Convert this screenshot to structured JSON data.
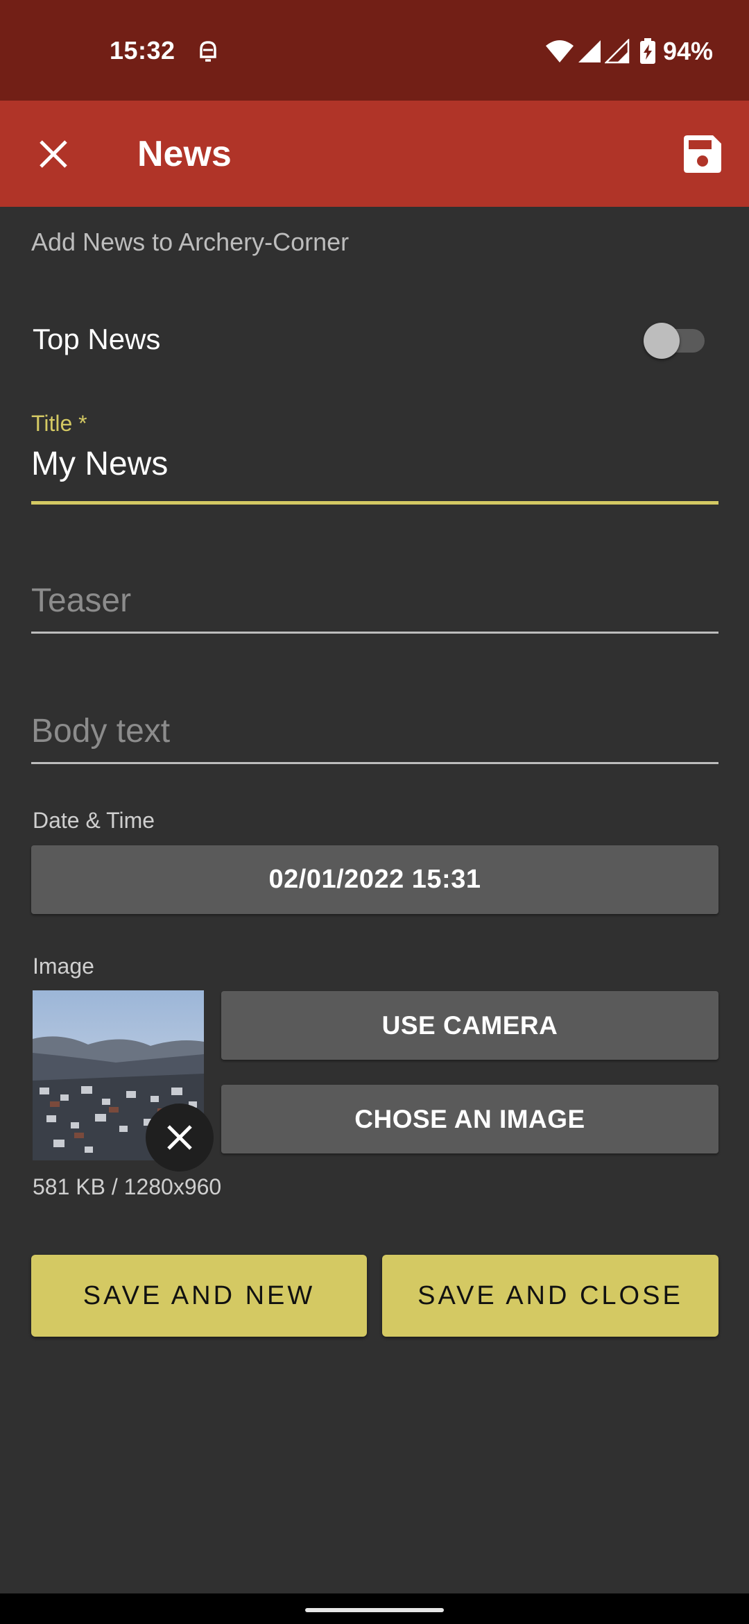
{
  "status_bar": {
    "time": "15:32",
    "notification_icon": "bell-icon",
    "wifi_icon": "wifi-icon",
    "signal_icon": "cell-signal-icon",
    "battery_icon": "battery-charging-icon",
    "battery_percent": "94%"
  },
  "app_bar": {
    "close_icon": "close-icon",
    "title": "News",
    "save_icon": "floppy-disk-icon",
    "color": "#b03428"
  },
  "form": {
    "subtitle": "Add News to Archery-Corner",
    "top_news": {
      "label": "Top News",
      "enabled": false
    },
    "title_field": {
      "label": "Title *",
      "value": "My News"
    },
    "teaser_field": {
      "placeholder": "Teaser"
    },
    "body_field": {
      "placeholder": "Body text"
    },
    "datetime": {
      "label": "Date & Time",
      "value": "02/01/2022 15:31"
    },
    "image": {
      "label": "Image",
      "use_camera_label": "USE CAMERA",
      "chose_image_label": "CHOSE AN IMAGE",
      "meta": "581 KB / 1280x960",
      "remove_icon": "close-icon"
    },
    "actions": {
      "save_and_new_label": "SAVE AND NEW",
      "save_and_close_label": "SAVE AND CLOSE",
      "accent_color": "#d4c963"
    }
  }
}
